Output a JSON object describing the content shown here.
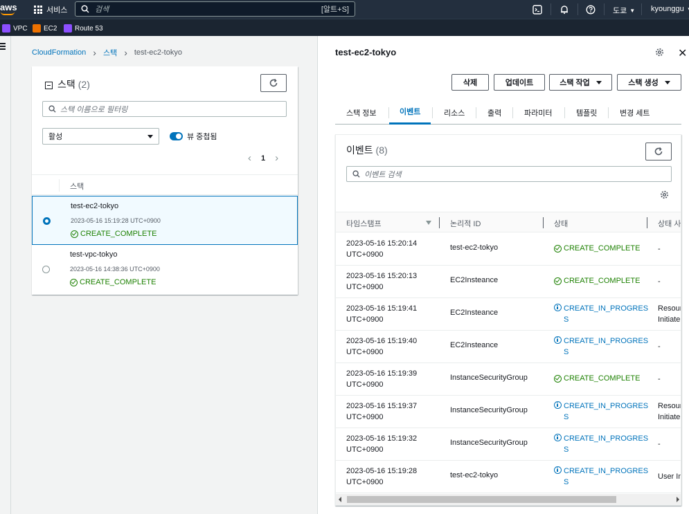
{
  "topnav": {
    "logo_text": "aws",
    "services_label": "서비스",
    "search_placeholder": "검색",
    "search_shortcut": "[알트+S]",
    "region": "도쿄",
    "user": "kyounggu"
  },
  "favorites": [
    {
      "label": "VPC",
      "color": "#8c4fff"
    },
    {
      "label": "EC2",
      "color": "#ed7100"
    },
    {
      "label": "Route 53",
      "color": "#8c4fff"
    }
  ],
  "breadcrumb": {
    "root": "CloudFormation",
    "section": "스택",
    "current": "test-ec2-tokyo"
  },
  "stacks_panel": {
    "title": "스택",
    "count": "(2)",
    "filter_placeholder": "스택 이름으로 필터링",
    "status_filter": "활성",
    "nested_toggle_label": "뷰 중첩됨",
    "page": "1",
    "column_header": "스택",
    "rows": [
      {
        "name": "test-ec2-tokyo",
        "timestamp": "2023-05-16 15:19:28 UTC+0900",
        "status": "CREATE_COMPLETE",
        "selected": true
      },
      {
        "name": "test-vpc-tokyo",
        "timestamp": "2023-05-16 14:38:36 UTC+0900",
        "status": "CREATE_COMPLETE",
        "selected": false
      }
    ]
  },
  "detail": {
    "title": "test-ec2-tokyo",
    "buttons": {
      "delete": "삭제",
      "update": "업데이트",
      "stack_actions": "스택 작업",
      "create_stack": "스택 생성"
    },
    "tabs": [
      "스택 정보",
      "이벤트",
      "리소스",
      "출력",
      "파라미터",
      "템플릿",
      "변경 세트"
    ],
    "active_tab": "이벤트"
  },
  "events_panel": {
    "title": "이벤트",
    "count": "(8)",
    "search_placeholder": "이벤트 검색",
    "columns": [
      "타임스탬프",
      "논리적 ID",
      "상태",
      "상태 사"
    ],
    "rows": [
      {
        "ts1": "2023-05-16 15:20:14",
        "ts2": "UTC+0900",
        "logical_id": "test-ec2-tokyo",
        "status": "CREATE_COMPLETE",
        "status2": "",
        "reason1": "-",
        "reason2": "",
        "kind": "ok"
      },
      {
        "ts1": "2023-05-16 15:20:13",
        "ts2": "UTC+0900",
        "logical_id": "EC2Insteance",
        "status": "CREATE_COMPLETE",
        "status2": "",
        "reason1": "-",
        "reason2": "",
        "kind": "ok"
      },
      {
        "ts1": "2023-05-16 15:19:41",
        "ts2": "UTC+0900",
        "logical_id": "EC2Insteance",
        "status": "CREATE_IN_PROGRES",
        "status2": "S",
        "reason1": "Resourc",
        "reason2": "Initiate",
        "kind": "prog"
      },
      {
        "ts1": "2023-05-16 15:19:40",
        "ts2": "UTC+0900",
        "logical_id": "EC2Insteance",
        "status": "CREATE_IN_PROGRES",
        "status2": "S",
        "reason1": "-",
        "reason2": "",
        "kind": "prog"
      },
      {
        "ts1": "2023-05-16 15:19:39",
        "ts2": "UTC+0900",
        "logical_id": "InstanceSecurityGroup",
        "status": "CREATE_COMPLETE",
        "status2": "",
        "reason1": "-",
        "reason2": "",
        "kind": "ok"
      },
      {
        "ts1": "2023-05-16 15:19:37",
        "ts2": "UTC+0900",
        "logical_id": "InstanceSecurityGroup",
        "status": "CREATE_IN_PROGRES",
        "status2": "S",
        "reason1": "Resourc",
        "reason2": "Initiate",
        "kind": "prog"
      },
      {
        "ts1": "2023-05-16 15:19:32",
        "ts2": "UTC+0900",
        "logical_id": "InstanceSecurityGroup",
        "status": "CREATE_IN_PROGRES",
        "status2": "S",
        "reason1": "-",
        "reason2": "",
        "kind": "prog"
      },
      {
        "ts1": "2023-05-16 15:19:28",
        "ts2": "UTC+0900",
        "logical_id": "test-ec2-tokyo",
        "status": "CREATE_IN_PROGRES",
        "status2": "S",
        "reason1": "User Ini",
        "reason2": "",
        "kind": "prog"
      }
    ]
  }
}
